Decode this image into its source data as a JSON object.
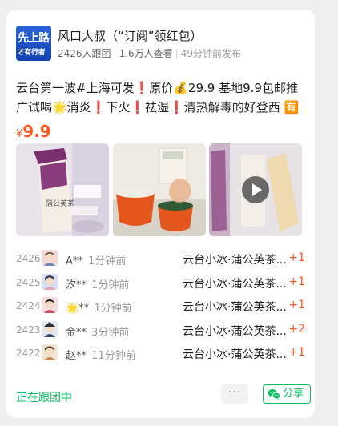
{
  "author": {
    "logo_text_top": "先上路",
    "logo_text_bottom": "才有行者",
    "name": "风口大叔（“订阅”领红包）",
    "followers": "2426人跟团",
    "views": "1.6万人查看",
    "published": "49分钟前发布"
  },
  "post": {
    "title": "云台第一波#上海可发❗原价💰29.9 基地9.9包邮推广试喝🌟消炎❗下火❗祛湿❗清热解毒的好登西 🈶🈶人...",
    "price_currency": "¥",
    "price_value": "9.9",
    "images": [
      {
        "icon": "tea-bag-product-photo"
      },
      {
        "icon": "tea-cups-photo"
      },
      {
        "icon": "video-thumbnail",
        "play_icon": "play-icon"
      }
    ]
  },
  "orders": [
    {
      "rank": "2426",
      "user": "A**",
      "time": "1分钟前",
      "product": "云台小冰·蒲公英茶...",
      "qty": "+1"
    },
    {
      "rank": "2425",
      "user": "汐**",
      "time": "1分钟前",
      "product": "云台小冰·蒲公英茶...",
      "qty": "+1"
    },
    {
      "rank": "2424",
      "user": "🌟**",
      "time": "1分钟前",
      "product": "云台小冰·蒲公英茶...",
      "qty": "+1"
    },
    {
      "rank": "2423",
      "user": "金**",
      "time": "3分钟前",
      "product": "云台小冰·蒲公英茶...",
      "qty": "+2"
    },
    {
      "rank": "2422",
      "user": "赵**",
      "time": "11分钟前",
      "product": "云台小冰·蒲公英茶...",
      "qty": "+1"
    }
  ],
  "footer": {
    "following": "正在跟团中",
    "more": "···",
    "share": "分享"
  },
  "colors": {
    "accent_orange": "#fa5a1e",
    "accent_green": "#07c160",
    "logo_blue": "#1243b0"
  }
}
